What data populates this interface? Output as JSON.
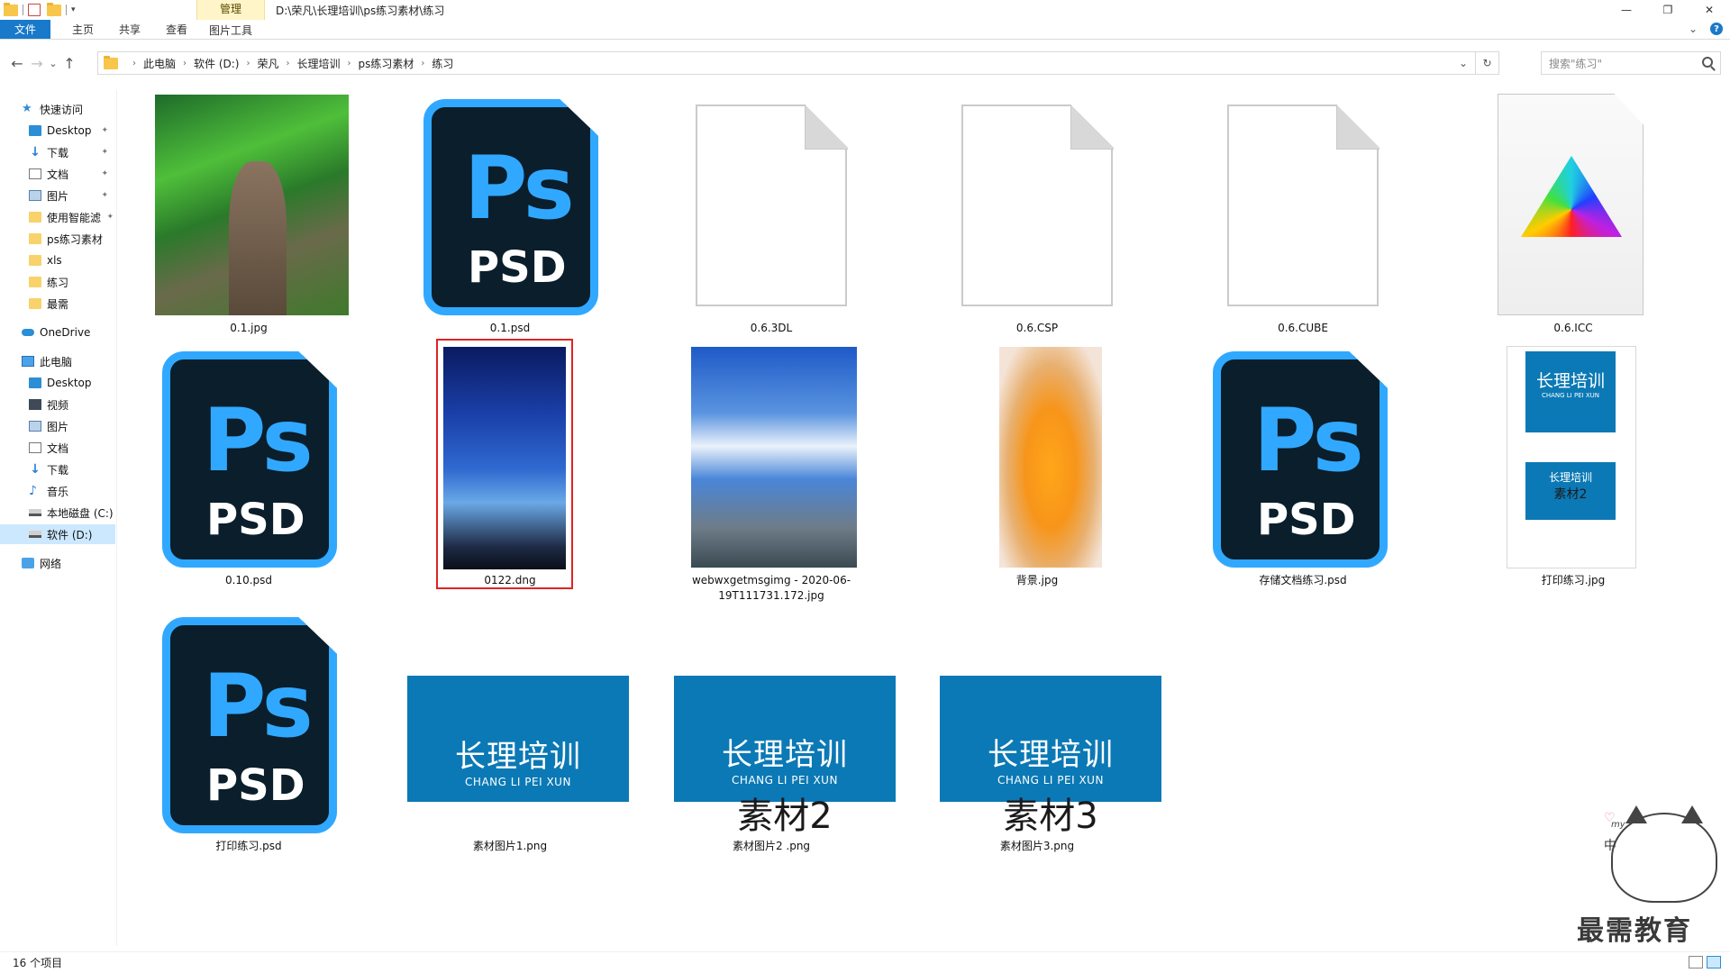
{
  "window": {
    "path_title": "D:\\荣凡\\长理培训\\ps练习素材\\练习",
    "context_tab_group": "管理",
    "minimize": "—",
    "maximize": "❐",
    "close": "✕"
  },
  "ribbon": {
    "tabs": [
      {
        "label": "文件"
      },
      {
        "label": "主页"
      },
      {
        "label": "共享"
      },
      {
        "label": "查看"
      }
    ],
    "context_tab": "图片工具",
    "collapse": "⌄",
    "help": "?"
  },
  "address": {
    "back": "←",
    "forward": "→",
    "recent": "⌄",
    "up": "↑",
    "crumbs": [
      "此电脑",
      "软件 (D:)",
      "荣凡",
      "长理培训",
      "ps练习素材",
      "练习"
    ],
    "crumb_sep": "›",
    "dropdown": "⌄",
    "refresh": "↻",
    "search_placeholder": "搜索\"练习\""
  },
  "sidebar": {
    "quick_access": "快速访问",
    "quick_items": [
      {
        "label": "Desktop",
        "pinned": true
      },
      {
        "label": "下载",
        "pinned": true
      },
      {
        "label": "文档",
        "pinned": true
      },
      {
        "label": "图片",
        "pinned": true
      },
      {
        "label": "使用智能滤",
        "pinned": true
      },
      {
        "label": "ps练习素材",
        "pinned": false
      },
      {
        "label": "xls",
        "pinned": false
      },
      {
        "label": "练习",
        "pinned": false
      },
      {
        "label": "最需",
        "pinned": false
      }
    ],
    "pin_glyph": "✦",
    "onedrive": "OneDrive",
    "this_pc": "此电脑",
    "pc_items": [
      {
        "label": "Desktop"
      },
      {
        "label": "视频"
      },
      {
        "label": "图片"
      },
      {
        "label": "文档"
      },
      {
        "label": "下载"
      },
      {
        "label": "音乐"
      },
      {
        "label": "本地磁盘 (C:)"
      },
      {
        "label": "软件 (D:)",
        "selected": true
      }
    ],
    "network": "网络"
  },
  "files": [
    {
      "name": "0.1.jpg",
      "kind": "photo-tree"
    },
    {
      "name": "0.1.psd",
      "kind": "psd"
    },
    {
      "name": "0.6.3DL",
      "kind": "blank"
    },
    {
      "name": "0.6.CSP",
      "kind": "blank"
    },
    {
      "name": "0.6.CUBE",
      "kind": "blank"
    },
    {
      "name": "0.6.ICC",
      "kind": "icc"
    },
    {
      "name": "0.10.psd",
      "kind": "psd"
    },
    {
      "name": "0122.dng",
      "kind": "photo-sky1",
      "selected": true
    },
    {
      "name": "webwxgetmsgimg - 2020-06-19T111731.172.jpg",
      "kind": "photo-sky2"
    },
    {
      "name": "背景.jpg",
      "kind": "photo-orange"
    },
    {
      "name": "存储文档练习.psd",
      "kind": "psd"
    },
    {
      "name": "打印练习.jpg",
      "kind": "print"
    },
    {
      "name": "打印练习.psd",
      "kind": "psd"
    },
    {
      "name": "素材图片1.png",
      "kind": "card"
    },
    {
      "name": "素材图片2 .png",
      "kind": "card"
    },
    {
      "name": "素材图片3.png",
      "kind": "card"
    }
  ],
  "psd_icon": {
    "ps": "Ps",
    "psd": "PSD"
  },
  "cards": {
    "main": "长理培训",
    "sub": "CHANG LI PEI XUN",
    "num2": "素材2",
    "num3": "素材3"
  },
  "status": {
    "count": "16 个项目"
  },
  "watermark": {
    "text": "最需教育",
    "zh": "中",
    "my": "my",
    "heart": "♡"
  }
}
